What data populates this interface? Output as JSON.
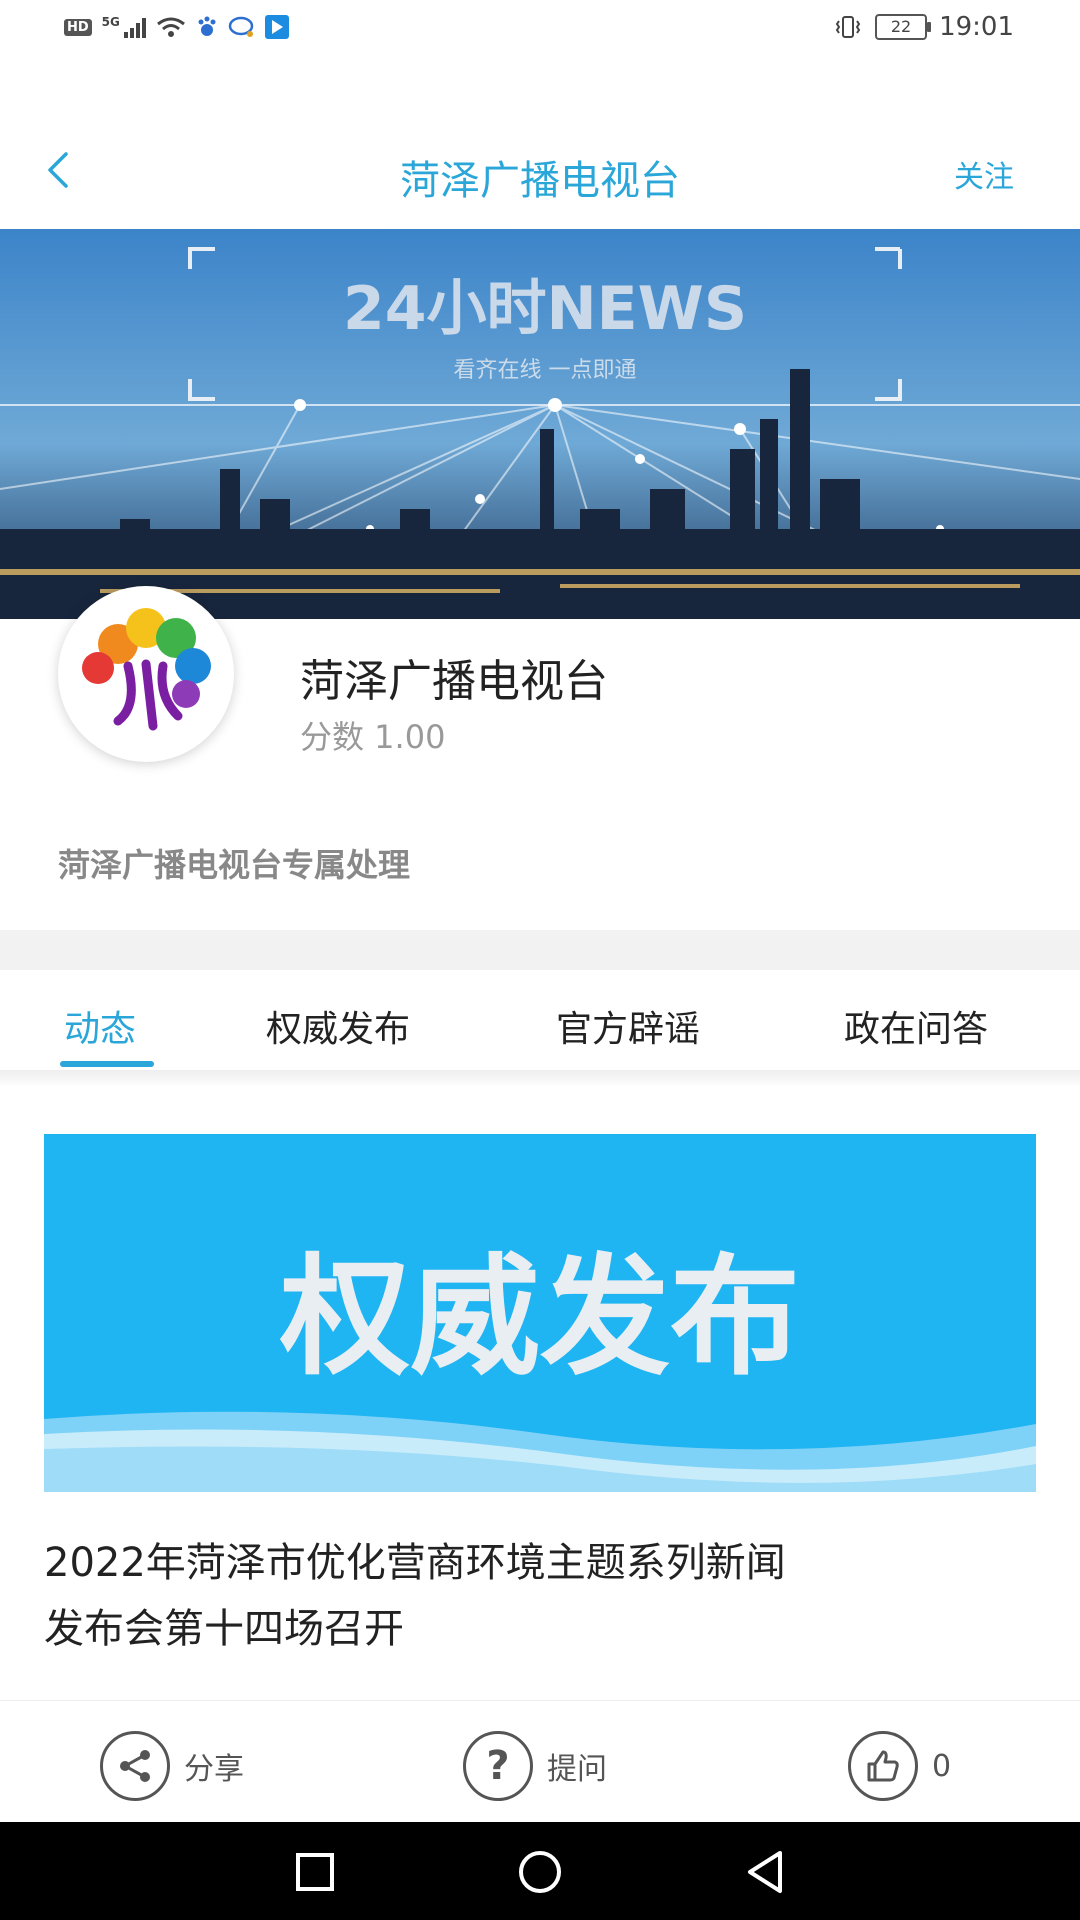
{
  "status_bar": {
    "left_badge": "HD",
    "network": "5G",
    "battery": "22",
    "time": "19:01"
  },
  "header": {
    "title": "菏泽广播电视台",
    "follow_label": "关注"
  },
  "banner": {
    "headline": "24小时NEWS",
    "subline": "看齐在线  一点即通"
  },
  "profile": {
    "name": "菏泽广播电视台",
    "score": "分数 1.00",
    "description": "菏泽广播电视台专属处理"
  },
  "tabs": [
    {
      "label": "动态",
      "active": true
    },
    {
      "label": "权威发布",
      "active": false
    },
    {
      "label": "官方辟谣",
      "active": false
    },
    {
      "label": "政在问答",
      "active": false
    }
  ],
  "card": {
    "image_text": "权威发布",
    "title_line1": "2022年菏泽市优化营商环境主题系列新闻",
    "title_line2": "发布会第十四场召开"
  },
  "actions": {
    "share_label": "分享",
    "ask_label": "提问",
    "like_count": "0"
  },
  "colors": {
    "accent": "#2aa6d9",
    "card_bg": "#1fb4f2"
  }
}
